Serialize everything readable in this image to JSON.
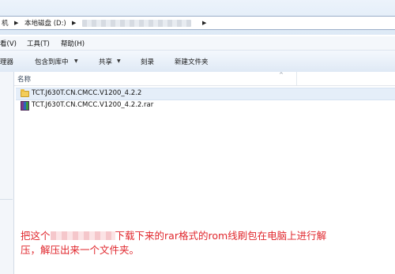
{
  "address_bar": {
    "crumb_partial": "机",
    "crumb_drive": "本地磁盘 (D:)"
  },
  "menu": {
    "view": "看(V)",
    "tools": "工具(T)",
    "help": "帮助(H)"
  },
  "toolbar": {
    "organize_partial": "理器",
    "include_in_library": "包含到库中",
    "share": "共享",
    "burn": "刻录",
    "new_folder": "新建文件夹",
    "dropdown_glyph": "▼"
  },
  "file_list": {
    "column_name": "名称",
    "sort_glyph": "^",
    "items": [
      {
        "name": "TCT.J630T.CN.CMCC.V1200_4.2.2",
        "type": "folder",
        "selected": true
      },
      {
        "name": "TCT.J630T.CN.CMCC.V1200_4.2.2.rar",
        "type": "rar-archive",
        "selected": false
      }
    ]
  },
  "caption": {
    "before": "把这个",
    "after_line1": "下载下来的rar格式的rom线刷包在电脑上进行解",
    "line2": "压，解压出来一个文件夹。"
  },
  "colors": {
    "caption_red": "#e0262c",
    "selection": "#e5eef9",
    "toolbar_gradient": "#dfe9f5"
  }
}
